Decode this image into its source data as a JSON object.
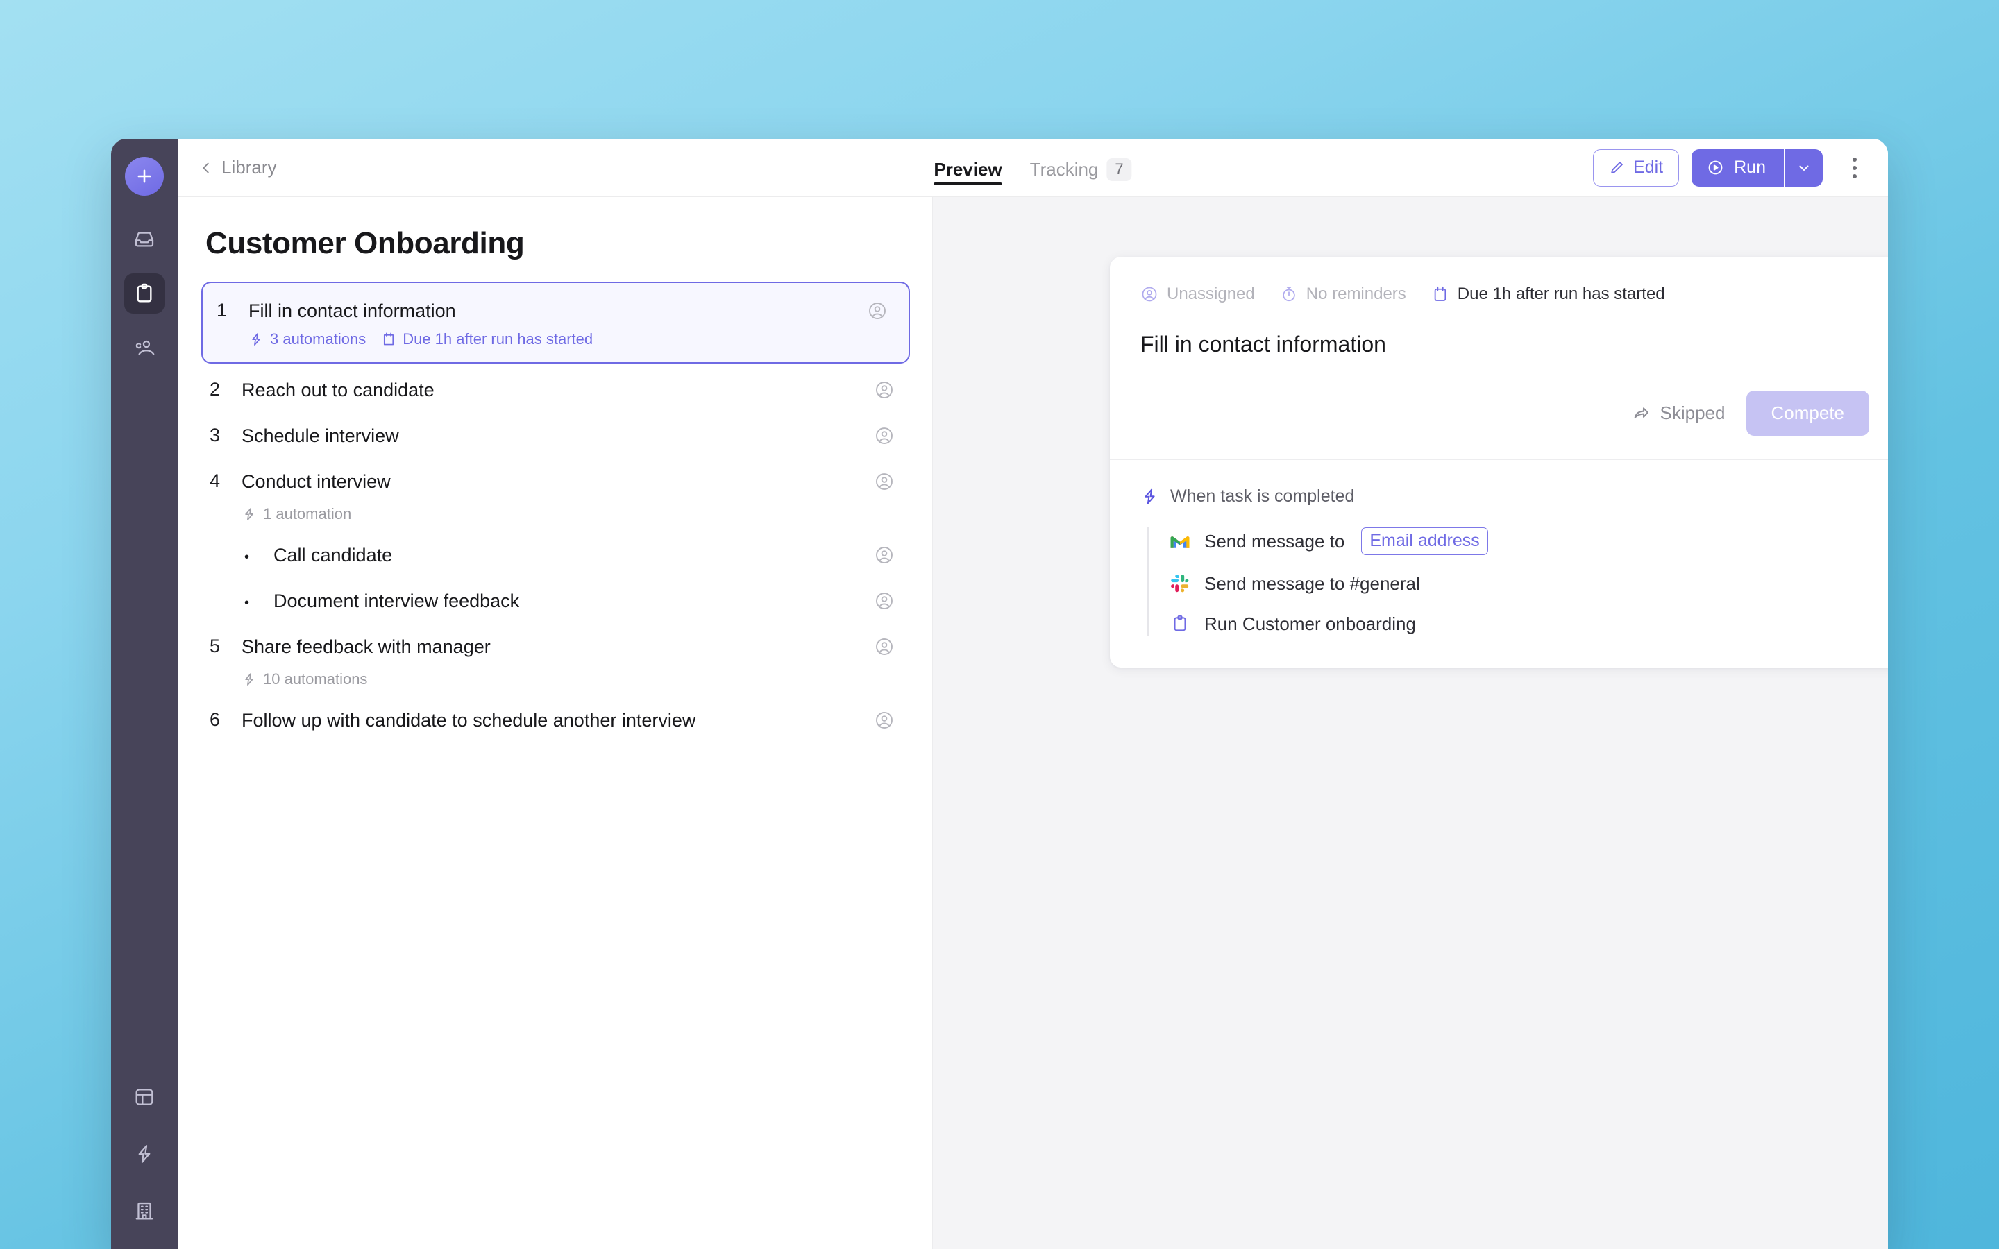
{
  "rail": {
    "add_label": "plus-icon",
    "items": [
      {
        "name": "inbox",
        "icon": "inbox-icon",
        "active": false
      },
      {
        "name": "library",
        "icon": "clipboard-icon",
        "active": true
      },
      {
        "name": "people",
        "icon": "people-icon",
        "active": false
      }
    ],
    "bottom_items": [
      {
        "name": "templates",
        "icon": "layout-icon"
      },
      {
        "name": "automations",
        "icon": "lightning-icon"
      },
      {
        "name": "organization",
        "icon": "building-icon"
      }
    ]
  },
  "topbar": {
    "back_label": "Library",
    "back_icon": "chevron-left-icon",
    "tabs": [
      {
        "label": "Preview",
        "badge": "",
        "active": true
      },
      {
        "label": "Tracking",
        "badge": "7",
        "active": false
      }
    ],
    "edit_label": "Edit",
    "edit_icon": "pencil-icon",
    "run_label": "Run",
    "run_icon": "play-circle-icon",
    "run_caret_icon": "chevron-down-icon",
    "more_icon": "kebab-menu-icon"
  },
  "list": {
    "title": "Customer Onboarding",
    "tasks": [
      {
        "num": "1",
        "title": "Fill in contact information",
        "selected": true,
        "sub": false,
        "meta": [
          {
            "icon": "lightning-icon",
            "label": "3 automations"
          },
          {
            "icon": "calendar-icon",
            "label": "Due 1h after run has started"
          }
        ]
      },
      {
        "num": "2",
        "title": "Reach out to candidate",
        "selected": false,
        "sub": false,
        "meta": []
      },
      {
        "num": "3",
        "title": "Schedule interview",
        "selected": false,
        "sub": false,
        "meta": []
      },
      {
        "num": "4",
        "title": "Conduct interview",
        "selected": false,
        "sub": false,
        "meta": [
          {
            "icon": "lightning-icon",
            "label": "1 automation"
          }
        ]
      },
      {
        "num": "•",
        "title": "Call candidate",
        "selected": false,
        "sub": true,
        "meta": []
      },
      {
        "num": "•",
        "title": "Document interview feedback",
        "selected": false,
        "sub": true,
        "meta": []
      },
      {
        "num": "5",
        "title": "Share feedback with manager",
        "selected": false,
        "sub": false,
        "meta": [
          {
            "icon": "lightning-icon",
            "label": "10 automations"
          }
        ]
      },
      {
        "num": "6",
        "title": "Follow up with candidate to schedule another interview",
        "selected": false,
        "sub": false,
        "meta": []
      }
    ]
  },
  "detail": {
    "chips": [
      {
        "icon": "user-circle-icon",
        "label": "Unassigned",
        "muted": true
      },
      {
        "icon": "stopwatch-icon",
        "label": "No reminders",
        "muted": true
      },
      {
        "icon": "calendar-icon",
        "label": "Due 1h after run has started",
        "muted": false
      }
    ],
    "title": "Fill in contact information",
    "skipped_label": "Skipped",
    "skipped_icon": "share-arrow-icon",
    "complete_label": "Compete",
    "trigger_icon": "lightning-icon",
    "trigger_label": "When task is completed",
    "automations": [
      {
        "icon": "gmail-icon",
        "text": "Send message to",
        "token": "Email address"
      },
      {
        "icon": "slack-icon",
        "text": "Send message to #general",
        "token": ""
      },
      {
        "icon": "clipboard-icon",
        "text": "Run Customer onboarding",
        "token": ""
      }
    ]
  },
  "colors": {
    "accent": "#6f6ae4",
    "accent_soft": "#c6c3f3",
    "rail_bg": "#474459",
    "detail_bg": "#f4f4f6",
    "desktop_bg": "#7fd0ea"
  }
}
